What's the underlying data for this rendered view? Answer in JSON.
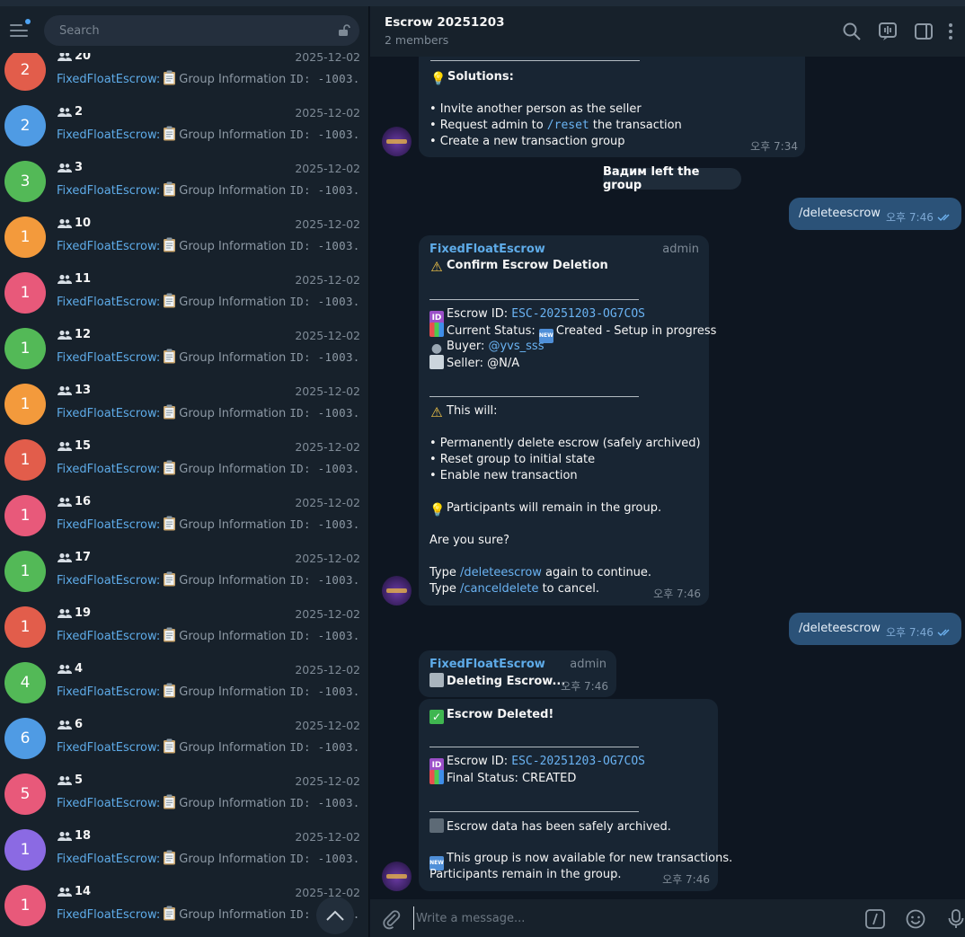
{
  "sidebar": {
    "search_placeholder": "Search",
    "chats": [
      {
        "badge": "2",
        "title": "20",
        "date": "2025-12-02",
        "color": "#e25d4b"
      },
      {
        "badge": "2",
        "title": "2",
        "date": "2025-12-02",
        "color": "#4f9be4"
      },
      {
        "badge": "3",
        "title": "3",
        "date": "2025-12-02",
        "color": "#53b957"
      },
      {
        "badge": "1",
        "title": "10",
        "date": "2025-12-02",
        "color": "#f39a3c"
      },
      {
        "badge": "1",
        "title": "11",
        "date": "2025-12-02",
        "color": "#e8597a"
      },
      {
        "badge": "1",
        "title": "12",
        "date": "2025-12-02",
        "color": "#53b957"
      },
      {
        "badge": "1",
        "title": "13",
        "date": "2025-12-02",
        "color": "#f39a3c"
      },
      {
        "badge": "1",
        "title": "15",
        "date": "2025-12-02",
        "color": "#e25d4b"
      },
      {
        "badge": "1",
        "title": "16",
        "date": "2025-12-02",
        "color": "#e8597a"
      },
      {
        "badge": "1",
        "title": "17",
        "date": "2025-12-02",
        "color": "#53b957"
      },
      {
        "badge": "1",
        "title": "19",
        "date": "2025-12-02",
        "color": "#e25d4b"
      },
      {
        "badge": "4",
        "title": "4",
        "date": "2025-12-02",
        "color": "#53b957"
      },
      {
        "badge": "6",
        "title": "6",
        "date": "2025-12-02",
        "color": "#4f9be4"
      },
      {
        "badge": "5",
        "title": "5",
        "date": "2025-12-02",
        "color": "#e8597a"
      },
      {
        "badge": "1",
        "title": "18",
        "date": "2025-12-02",
        "color": "#8b6ae3"
      },
      {
        "badge": "1",
        "title": "14",
        "date": "2025-12-02",
        "color": "#e8597a"
      }
    ],
    "preview_sender": "FixedFloatEscrow:",
    "preview_text": "Group Information",
    "preview_id": "ID: -1003..."
  },
  "header": {
    "title": "Escrow 20251203",
    "subtitle": "2 members"
  },
  "messages": {
    "m1": {
      "solutions_title": "Solutions:",
      "line1": "• Invite another person as the seller",
      "line2_a": "• Request admin to ",
      "line2_cmd": "/reset",
      "line2_b": " the transaction",
      "line3": "• Create a new transaction group",
      "time": "오후 7:34"
    },
    "service": "Вадим left the group",
    "out1": {
      "text": "/deleteescrow",
      "time": "오후 7:46"
    },
    "m2": {
      "name": "FixedFloatEscrow",
      "role": "admin",
      "title": "Confirm Escrow Deletion",
      "id_label": "Escrow ID: ",
      "id_value": "ESC-20251203-OG7COS",
      "status_label": "Current Status: ",
      "status_value": "Created - Setup in progress",
      "buyer_label": "Buyer: ",
      "buyer_value": "@yvs_sss",
      "seller": "Seller: @N/A",
      "this_will": "This will:",
      "b1": "• Permanently delete escrow (safely archived)",
      "b2": "• Reset group to initial state",
      "b3": "• Enable new transaction",
      "participants": "Participants will remain in the group.",
      "sure": "Are you sure?",
      "type1_a": "Type ",
      "type1_cmd": "/deleteescrow",
      "type1_b": " again to continue.",
      "type2_a": "Type ",
      "type2_cmd": "/canceldelete",
      "type2_b": " to cancel.",
      "time": "오후 7:46"
    },
    "out2": {
      "text": "/deleteescrow",
      "time": "오후 7:46"
    },
    "m3": {
      "name": "FixedFloatEscrow",
      "role": "admin",
      "text": "Deleting Escrow...",
      "time": "오후 7:46"
    },
    "m4": {
      "title": "Escrow Deleted!",
      "id_label": "Escrow ID: ",
      "id_value": "ESC-20251203-OG7COS",
      "final_status": "Final Status: CREATED",
      "archived": "Escrow data has been safely archived.",
      "available": "This group is now available for new transactions.",
      "remain": "Participants remain in the group.",
      "time": "오후 7:46"
    }
  },
  "composer": {
    "placeholder": "Write a message..."
  },
  "emoji_text": {
    "id": "ID",
    "new": "NEW"
  }
}
